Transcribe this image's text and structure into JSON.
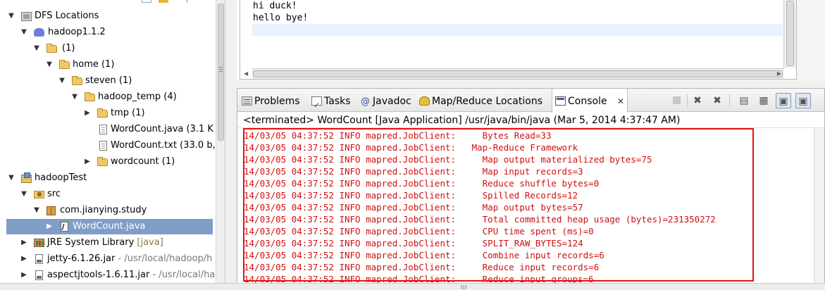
{
  "tree": {
    "rows": [
      {
        "label": "DFS Locations",
        "suffix": ""
      },
      {
        "label": "hadoop1.1.2",
        "suffix": ""
      },
      {
        "label": "(1)",
        "suffix": ""
      },
      {
        "label": "home (1)",
        "suffix": ""
      },
      {
        "label": "steven (1)",
        "suffix": ""
      },
      {
        "label": "hadoop_temp (4)",
        "suffix": ""
      },
      {
        "label": "tmp (1)",
        "suffix": ""
      },
      {
        "label": "WordCount.java (3.1 K",
        "suffix": ""
      },
      {
        "label": "WordCount.txt (33.0 b,",
        "suffix": ""
      },
      {
        "label": "wordcount (1)",
        "suffix": ""
      },
      {
        "label": "hadoopTest",
        "suffix": ""
      },
      {
        "label": "src",
        "suffix": ""
      },
      {
        "label": "com.jianying.study",
        "suffix": ""
      },
      {
        "label": "WordCount.java",
        "suffix": ""
      },
      {
        "label": "JRE System Library",
        "suffix": "[java]"
      },
      {
        "label": "jetty-6.1.26.jar",
        "suffix": "- /usr/local/hadoop/h"
      },
      {
        "label": "aspectjtools-1.6.11.jar",
        "suffix": "- /usr/local/ha"
      }
    ]
  },
  "editor": {
    "lines": [
      "hi duck!",
      "hello bye!",
      ""
    ]
  },
  "console_view": {
    "tabs": [
      {
        "label": "Problems",
        "icon": "problems-icon"
      },
      {
        "label": "Tasks",
        "icon": "tasks-icon"
      },
      {
        "label": "Javadoc",
        "icon": "javadoc-icon"
      },
      {
        "label": "Map/Reduce Locations",
        "icon": "mapreduce-locations-icon"
      },
      {
        "label": "Console",
        "icon": "console-icon",
        "active": true
      }
    ],
    "close_glyph": "✕",
    "process_label": "<terminated> WordCount [Java Application] /usr/java/bin/java (Mar 5, 2014 4:37:47 AM)",
    "toolbar": [
      {
        "name": "terminate-icon",
        "glyph": "",
        "disabled": true
      },
      {
        "name": "remove-launch-icon",
        "glyph": "✖",
        "disabled": false
      },
      {
        "name": "remove-all-terminated-icon",
        "glyph": "✖",
        "disabled": false
      },
      {
        "name": "clear-console-icon",
        "glyph": "▤",
        "disabled": false
      },
      {
        "name": "scroll-lock-icon",
        "glyph": "▦",
        "disabled": false
      },
      {
        "name": "show-console-on-output-icon",
        "glyph": "▣",
        "disabled": false,
        "pressed": true
      },
      {
        "name": "show-console-on-error-icon",
        "glyph": "▣",
        "disabled": false,
        "pressed": true
      }
    ],
    "output_lines": [
      "14/03/05 04:37:52 INFO mapred.JobClient:     Bytes Read=33",
      "14/03/05 04:37:52 INFO mapred.JobClient:   Map-Reduce Framework",
      "14/03/05 04:37:52 INFO mapred.JobClient:     Map output materialized bytes=75",
      "14/03/05 04:37:52 INFO mapred.JobClient:     Map input records=3",
      "14/03/05 04:37:52 INFO mapred.JobClient:     Reduce shuffle bytes=0",
      "14/03/05 04:37:52 INFO mapred.JobClient:     Spilled Records=12",
      "14/03/05 04:37:52 INFO mapred.JobClient:     Map output bytes=57",
      "14/03/05 04:37:52 INFO mapred.JobClient:     Total committed heap usage (bytes)=231350272",
      "14/03/05 04:37:52 INFO mapred.JobClient:     CPU time spent (ms)=0",
      "14/03/05 04:37:52 INFO mapred.JobClient:     SPLIT_RAW_BYTES=124",
      "14/03/05 04:37:52 INFO mapred.JobClient:     Combine input records=6",
      "14/03/05 04:37:52 INFO mapred.JobClient:     Reduce input records=6",
      "14/03/05 04:37:52 INFO mapred.JobClient:     Reduce input groups=6"
    ],
    "output_color": "#d01010",
    "highlight_color": "#e81010"
  }
}
